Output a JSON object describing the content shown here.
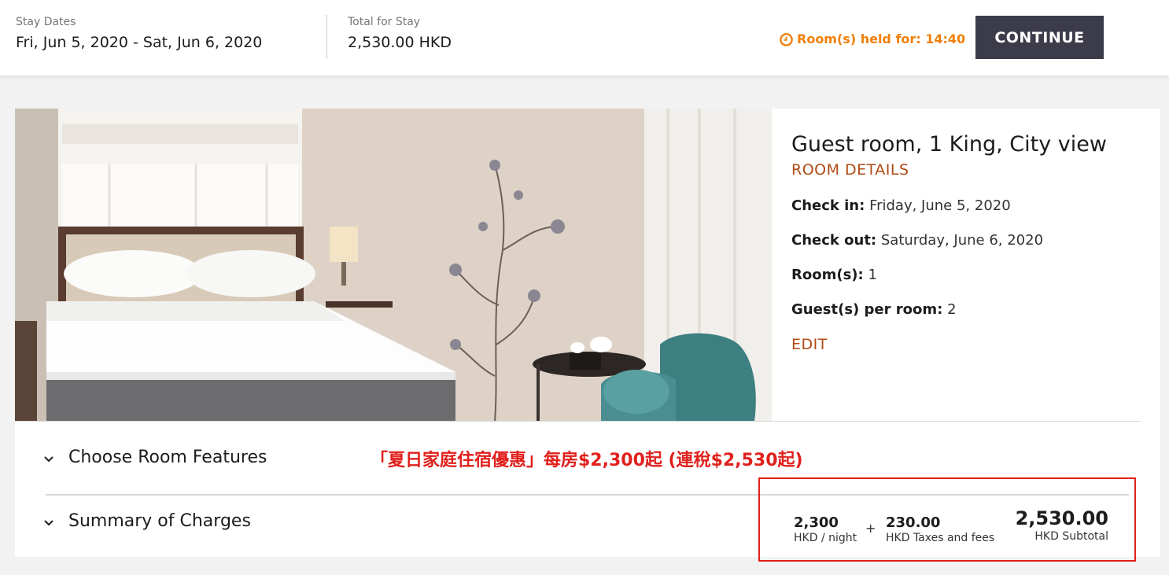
{
  "topbar": {
    "stay_dates_label": "Stay Dates",
    "stay_dates_value": "Fri, Jun 5, 2020 - Sat, Jun 6, 2020",
    "total_label": "Total for Stay",
    "total_value": "2,530.00 HKD",
    "held_text": "Room(s) held for: 14:40",
    "continue_label": "CONTINUE"
  },
  "room": {
    "title": "Guest room, 1 King, City view",
    "details_link": "ROOM DETAILS",
    "checkin_label": "Check in:",
    "checkin_value": "Friday, June 5, 2020",
    "checkout_label": "Check out:",
    "checkout_value": "Saturday, June 6, 2020",
    "rooms_label": "Room(s):",
    "rooms_value": "1",
    "guests_label": "Guest(s) per room:",
    "guests_value": "2",
    "edit_link": "EDIT"
  },
  "sections": {
    "features": "Choose Room Features",
    "summary": "Summary of Charges"
  },
  "promo_text": "「夏日家庭住宿優惠」每房$2,300起 (連稅$2,530起)",
  "charges": {
    "nightly_value": "2,300",
    "nightly_label": "HKD / night",
    "plus": "+",
    "taxes_value": "230.00",
    "taxes_label": "HKD Taxes and fees",
    "subtotal_value": "2,530.00",
    "subtotal_label": "HKD Subtotal"
  },
  "colors": {
    "accent_link": "#b04a14",
    "timer": "#f0800a",
    "button_bg": "#3c3b4a",
    "annotation_red": "#e0201c"
  },
  "icons": [
    "clock-icon",
    "chevron-down-icon"
  ]
}
